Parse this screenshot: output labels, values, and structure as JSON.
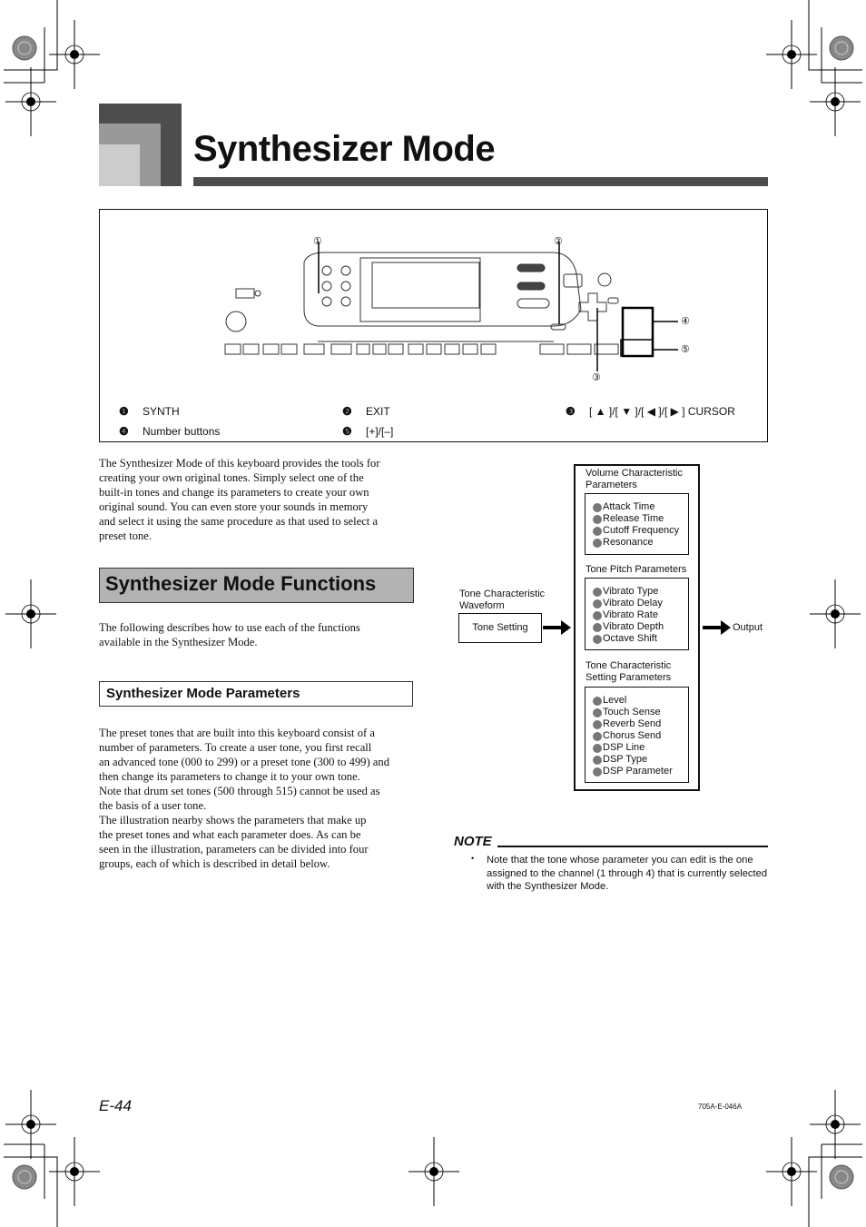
{
  "page_title": "Synthesizer Mode",
  "figure": {
    "callouts": [
      "①",
      "②",
      "③",
      "④",
      "⑤"
    ],
    "legend": [
      {
        "num": "❶",
        "label": "SYNTH"
      },
      {
        "num": "❷",
        "label": "EXIT"
      },
      {
        "num": "❸",
        "label": "[ ▲ ]/[ ▼ ]/[ ◀ ]/[ ▶ ] CURSOR"
      },
      {
        "num": "❹",
        "label": "Number buttons"
      },
      {
        "num": "❺",
        "label": "[+]/[–]"
      }
    ]
  },
  "intro_lines": [
    "The Synthesizer Mode of this keyboard provides the tools for",
    "creating your own original tones. Simply select one of the",
    "built-in tones and change its parameters to create your own",
    "original sound. You can even store your sounds in memory",
    "and select it using the same procedure as that used to select a",
    "preset tone."
  ],
  "section_heading": "Synthesizer Mode Functions",
  "section_lines": [
    "The following describes how to use each of the functions",
    "available in the Synthesizer Mode."
  ],
  "sub_heading": "Synthesizer Mode Parameters",
  "param_lines": [
    "The preset tones that are built into this keyboard consist of a",
    "number of parameters. To create a user tone, you first recall",
    "an advanced tone (000 to 299) or a preset tone (300 to 499) and",
    "then change its parameters to change it to your own tone.",
    "Note that drum set tones (500 through 515) cannot be used as",
    "the basis of a user tone.",
    "The illustration nearby shows the parameters that make up",
    "the preset tones and what each parameter does. As can be",
    "seen in the illustration, parameters can be divided into four",
    "groups, each of which is described in detail below."
  ],
  "diagram": {
    "waveform_label": [
      "Tone Characteristic",
      "Waveform"
    ],
    "tone_setting": "Tone Setting",
    "output": "Output",
    "groups": [
      {
        "title": [
          "Volume Characteristic",
          "Parameters"
        ],
        "items": [
          "Attack Time",
          "Release Time",
          "Cutoff Frequency",
          "Resonance"
        ]
      },
      {
        "title": [
          "Tone Pitch Parameters"
        ],
        "items": [
          "Vibrato Type",
          "Vibrato Delay",
          "Vibrato Rate",
          "Vibrato Depth",
          "Octave Shift"
        ]
      },
      {
        "title": [
          "Tone Characteristic",
          "Setting Parameters"
        ],
        "items": [
          "Level",
          "Touch Sense",
          "Reverb Send",
          "Chorus Send",
          "DSP Line",
          "DSP Type",
          "DSP Parameter"
        ]
      }
    ]
  },
  "note": {
    "title": "NOTE",
    "bullet": "•",
    "text": "Note that the tone whose parameter you can edit is the one assigned to the channel (1 through 4) that is currently selected with the Synthesizer Mode."
  },
  "footer": {
    "page": "E-44",
    "code": "705A-E-046A"
  }
}
